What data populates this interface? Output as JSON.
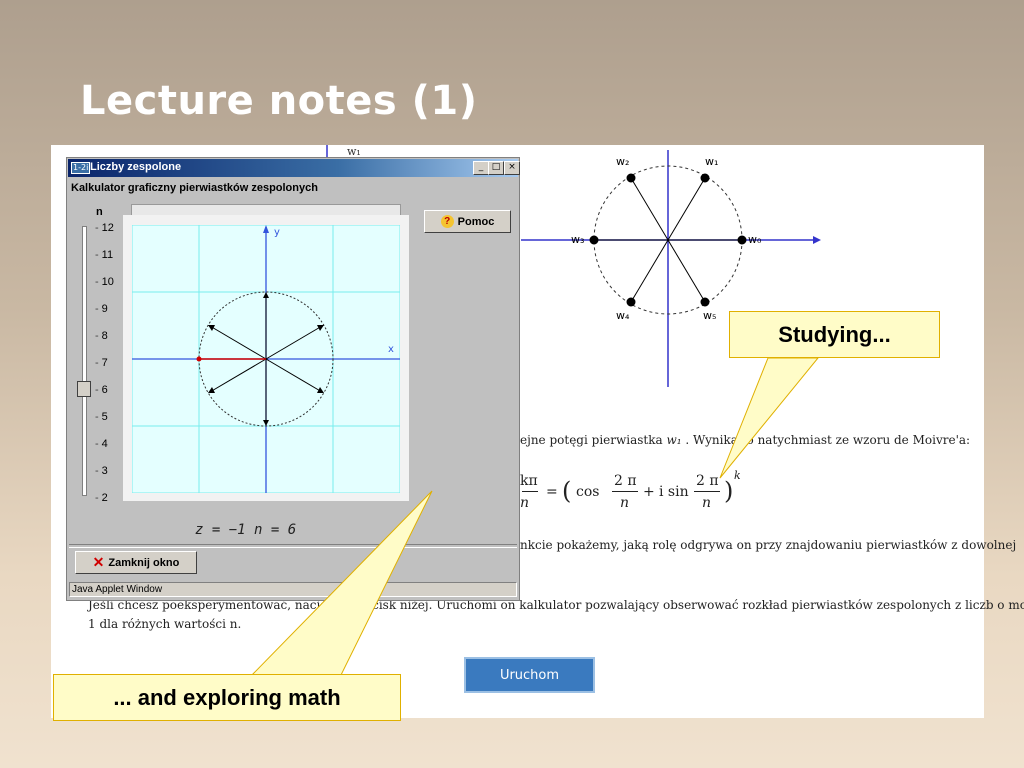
{
  "slide": {
    "title": "Lecture notes (1)"
  },
  "document": {
    "top_label": "w₁",
    "roots_labels": [
      "w₂",
      "w₁",
      "w₃",
      "w₀",
      "w₄",
      "w₅"
    ],
    "text_line1_a": "ejne potęgi pierwiastka",
    "text_line1_sym": "w₁",
    "text_line1_b": ". Wynika to natychmiast ze wzoru de Moivre'a:",
    "formula_left": "kπ",
    "formula_left_den": "n",
    "formula_eq": "=",
    "formula_cos": "cos",
    "formula_plus": "+",
    "formula_isin": "i sin",
    "formula_num": "2 π",
    "formula_den": "n",
    "formula_exp": "k",
    "text_line3": "nkcie pokażemy, jaką rolę odgrywa on przy znajdowaniu pierwiastków z dowolnej",
    "text_line4": "Jeśli chcesz poeksperymentować, naciśnij przycisk niżej. Uruchomi on kalkulator pozwalający obserwować rozkład pierwiastków zespolonych z liczb o module",
    "text_line5": "1   dla różnych wartości n.",
    "run_button": "Uruchom"
  },
  "applet": {
    "window_icon": "1-2i",
    "title": "Liczby zespolone",
    "subtitle": "Kalkulator graficzny pierwiastków zespolonych",
    "n_label": "n",
    "ticks": [
      "12",
      "11",
      "10",
      "9",
      "8",
      "7",
      "6",
      "5",
      "4",
      "3",
      "2"
    ],
    "slider_value": 6,
    "axis_x": "x",
    "axis_y": "y",
    "status_equation": "z = −1  n = 6",
    "help_button": "Pomoc",
    "close_button": "Zamknij okno",
    "status_bar": "Java Applet Window",
    "window_buttons": [
      "_",
      "□",
      "×"
    ]
  },
  "callouts": {
    "studying": "Studying...",
    "exploring": "... and exploring math"
  },
  "colors": {
    "accent_blue": "#3a7abf",
    "callout_fill": "#fffcc8",
    "callout_border": "#e0b000",
    "titlebar": "#0a246a"
  }
}
